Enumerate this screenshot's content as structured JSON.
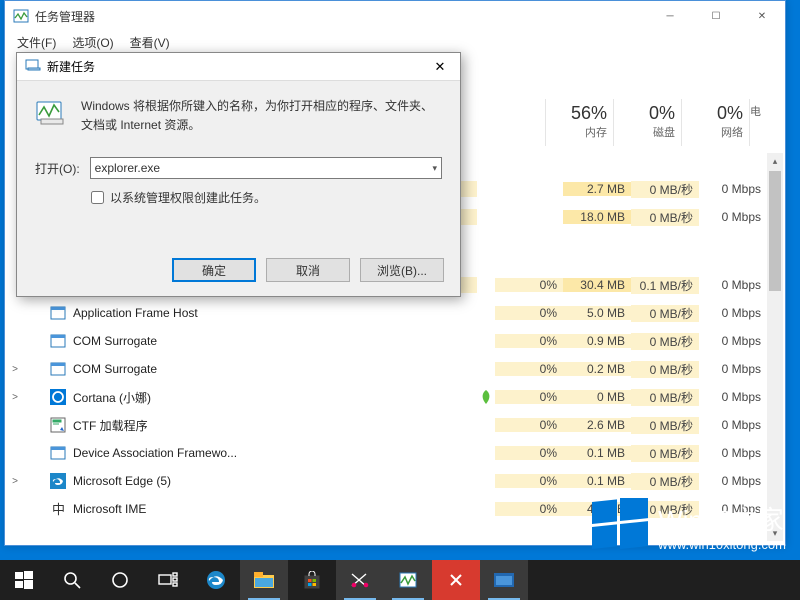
{
  "taskmgr": {
    "title": "任务管理器",
    "menu": {
      "file": "文件(F)",
      "options": "选项(O)",
      "view": "查看(V)"
    },
    "cols": {
      "mem_pct": "56%",
      "mem_lbl": "内存",
      "disk_pct": "0%",
      "disk_lbl": "磁盘",
      "net_pct": "0%",
      "net_lbl": "网络",
      "extra": "电"
    },
    "rows": [
      {
        "exp": "",
        "name": "",
        "cpu": "",
        "mem": "2.7 MB",
        "disk": "0 MB/秒",
        "net": "0 Mbps",
        "icon": "blank",
        "hl": true
      },
      {
        "exp": "",
        "name": "",
        "cpu": "",
        "mem": "18.0 MB",
        "disk": "0 MB/秒",
        "net": "0 Mbps",
        "icon": "blank",
        "hl": true
      },
      {
        "exp": "",
        "name": "",
        "cpu": "",
        "mem": "",
        "disk": "",
        "net": "",
        "icon": "blank",
        "spacer": true
      },
      {
        "exp": "",
        "name": "",
        "cpu": "0%",
        "mem": "30.4 MB",
        "disk": "0.1 MB/秒",
        "net": "0 Mbps",
        "icon": "blank",
        "hl": true
      },
      {
        "exp": "",
        "name": "Application Frame Host",
        "cpu": "0%",
        "mem": "5.0 MB",
        "disk": "0 MB/秒",
        "net": "0 Mbps",
        "icon": "app"
      },
      {
        "exp": "",
        "name": "COM Surrogate",
        "cpu": "0%",
        "mem": "0.9 MB",
        "disk": "0 MB/秒",
        "net": "0 Mbps",
        "icon": "app"
      },
      {
        "exp": ">",
        "name": "COM Surrogate",
        "cpu": "0%",
        "mem": "0.2 MB",
        "disk": "0 MB/秒",
        "net": "0 Mbps",
        "icon": "app"
      },
      {
        "exp": ">",
        "name": "Cortana (小娜)",
        "cpu": "0%",
        "mem": "0 MB",
        "disk": "0 MB/秒",
        "net": "0 Mbps",
        "icon": "cortana",
        "leaf": true
      },
      {
        "exp": "",
        "name": "CTF 加载程序",
        "cpu": "0%",
        "mem": "2.6 MB",
        "disk": "0 MB/秒",
        "net": "0 Mbps",
        "icon": "ctf"
      },
      {
        "exp": "",
        "name": "Device Association Framewo...",
        "cpu": "0%",
        "mem": "0.1 MB",
        "disk": "0 MB/秒",
        "net": "0 Mbps",
        "icon": "app"
      },
      {
        "exp": ">",
        "name": "Microsoft Edge (5)",
        "cpu": "0%",
        "mem": "0.1 MB",
        "disk": "0 MB/秒",
        "net": "0 Mbps",
        "icon": "edge"
      },
      {
        "exp": "",
        "name": "Microsoft IME",
        "cpu": "0%",
        "mem": "4.1 MB",
        "disk": "0 MB/秒",
        "net": "0 Mbps",
        "icon": "ime"
      }
    ]
  },
  "dialog": {
    "title": "新建任务",
    "desc": "Windows 将根据你所键入的名称，为你打开相应的程序、文件夹、文档或 Internet 资源。",
    "open_label": "打开(O):",
    "open_value": "explorer.exe",
    "admin_label": "以系统管理权限创建此任务。",
    "ok": "确定",
    "cancel": "取消",
    "browse": "浏览(B)..."
  },
  "watermark": {
    "brand": "Win10之家",
    "url": "www.win10xitong.com"
  }
}
